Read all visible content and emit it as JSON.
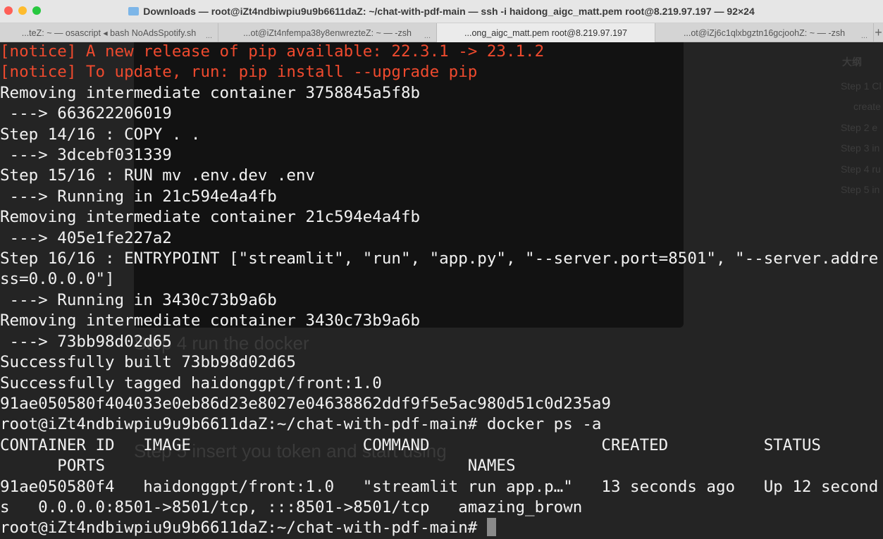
{
  "window": {
    "title": "Downloads — root@iZt4ndbiwpiu9u9b6611daZ: ~/chat-with-pdf-main — ssh -i haidong_aigc_matt.pem root@8.219.97.197 — 92×24"
  },
  "tabs": [
    {
      "label": "...teZ: ~ — osascript ◂ bash NoAdsSpotify.sh"
    },
    {
      "label": "...ot@iZt4nfempa38y8enwrezteZ: ~ — -zsh"
    },
    {
      "label": "...ong_aigc_matt.pem root@8.219.97.197"
    },
    {
      "label": "...ot@iZj6c1qlxbgztn16gcjoohZ: ~ — -zsh"
    }
  ],
  "tab_more": "...",
  "new_tab": "+",
  "background": {
    "heading_step4": "Step 4 run the docker",
    "heading_step5": "Step 5 insert you token and start using",
    "outline_title": "大纲",
    "outline_items": [
      "Step 1 Cl",
      "create",
      "Step 2 e",
      "Step 3 in",
      "Step 4 ru",
      "Step 5 in"
    ]
  },
  "terminal": {
    "lines": [
      "[notice] A new release of pip available: 22.3.1 -> 23.1.2",
      "[notice] To update, run: pip install --upgrade pip",
      "Removing intermediate container 3758845a5f8b",
      " ---> 663622206019",
      "Step 14/16 : COPY . .",
      " ---> 3dcebf031339",
      "Step 15/16 : RUN mv .env.dev .env",
      " ---> Running in 21c594e4a4fb",
      "Removing intermediate container 21c594e4a4fb",
      " ---> 405e1fe227a2",
      "Step 16/16 : ENTRYPOINT [\"streamlit\", \"run\", \"app.py\", \"--server.port=8501\", \"--server.addre",
      "ss=0.0.0.0\"]",
      " ---> Running in 3430c73b9a6b",
      "Removing intermediate container 3430c73b9a6b",
      " ---> 73bb98d02d65",
      "Successfully built 73bb98d02d65",
      "Successfully tagged haidonggpt/front:1.0",
      "91ae050580f404033e0eb86d23e8027e04638862ddf9f5e5ac980d51c0d235a9",
      "root@iZt4ndbiwpiu9u9b6611daZ:~/chat-with-pdf-main# docker ps -a",
      "CONTAINER ID   IMAGE                  COMMAND                  CREATED          STATUS",
      "      PORTS                                      NAMES",
      "91ae050580f4   haidonggpt/front:1.0   \"streamlit run app.p…\"   13 seconds ago   Up 12 second",
      "s   0.0.0.0:8501->8501/tcp, :::8501->8501/tcp   amazing_brown",
      "root@iZt4ndbiwpiu9u9b6611daZ:~/chat-with-pdf-main# "
    ]
  },
  "colors": {
    "notice": "#ef4a2e",
    "text": "#f2f2f2",
    "bg": "#242424"
  }
}
